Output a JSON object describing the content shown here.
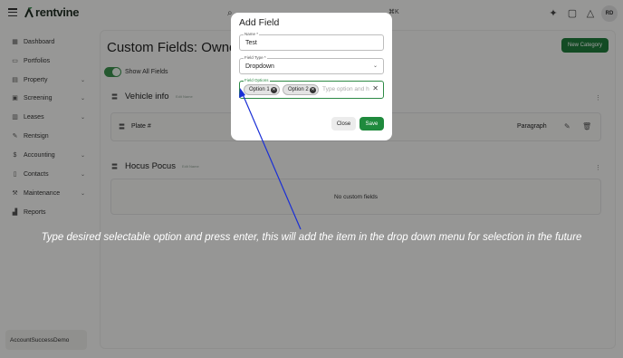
{
  "app": {
    "logo_text": "rentvine",
    "kbd_hint": "⌘K",
    "avatar_initials": "RD"
  },
  "sidebar": {
    "items": [
      {
        "label": "Dashboard",
        "icon": "grid-icon",
        "has_chevron": false
      },
      {
        "label": "Portfolios",
        "icon": "folder-icon",
        "has_chevron": false
      },
      {
        "label": "Property",
        "icon": "building-icon",
        "has_chevron": true
      },
      {
        "label": "Screening",
        "icon": "screening-icon",
        "has_chevron": true
      },
      {
        "label": "Leases",
        "icon": "lease-icon",
        "has_chevron": true
      },
      {
        "label": "Rentsign",
        "icon": "pen-icon",
        "has_chevron": false
      },
      {
        "label": "Accounting",
        "icon": "dollar-icon",
        "has_chevron": true
      },
      {
        "label": "Contacts",
        "icon": "book-icon",
        "has_chevron": true
      },
      {
        "label": "Maintenance",
        "icon": "wrench-icon",
        "has_chevron": true
      },
      {
        "label": "Reports",
        "icon": "chart-icon",
        "has_chevron": false
      }
    ],
    "account_name": "AccountSuccessDemo"
  },
  "main": {
    "title": "Custom Fields: Owner",
    "new_category_label": "New Category",
    "show_all_label": "Show All Fields",
    "categories": [
      {
        "title": "Vehicle info",
        "link": "Edit Name",
        "fields": [
          {
            "name": "Plate #",
            "type": "Paragraph"
          }
        ]
      },
      {
        "title": "Hocus Pocus",
        "link": "Edit Name",
        "empty_text": "No custom fields"
      }
    ]
  },
  "modal": {
    "title": "Add Field",
    "name_label": "Name *",
    "name_value": "Test",
    "type_label": "Field Type *",
    "type_value": "Dropdown",
    "options_label": "Field Options",
    "options": [
      "Option 1",
      "Option 2"
    ],
    "options_placeholder": "Type option and hit enter",
    "close_label": "Close",
    "save_label": "Save"
  },
  "annotation": {
    "caption": "Type desired selectable option and press enter, this will add the item in the drop down menu for selection in the future",
    "arrow_color": "#1a2fd6"
  },
  "colors": {
    "accent_green": "#1f7a3a",
    "overlay": "rgba(0,0,0,0.38)"
  }
}
